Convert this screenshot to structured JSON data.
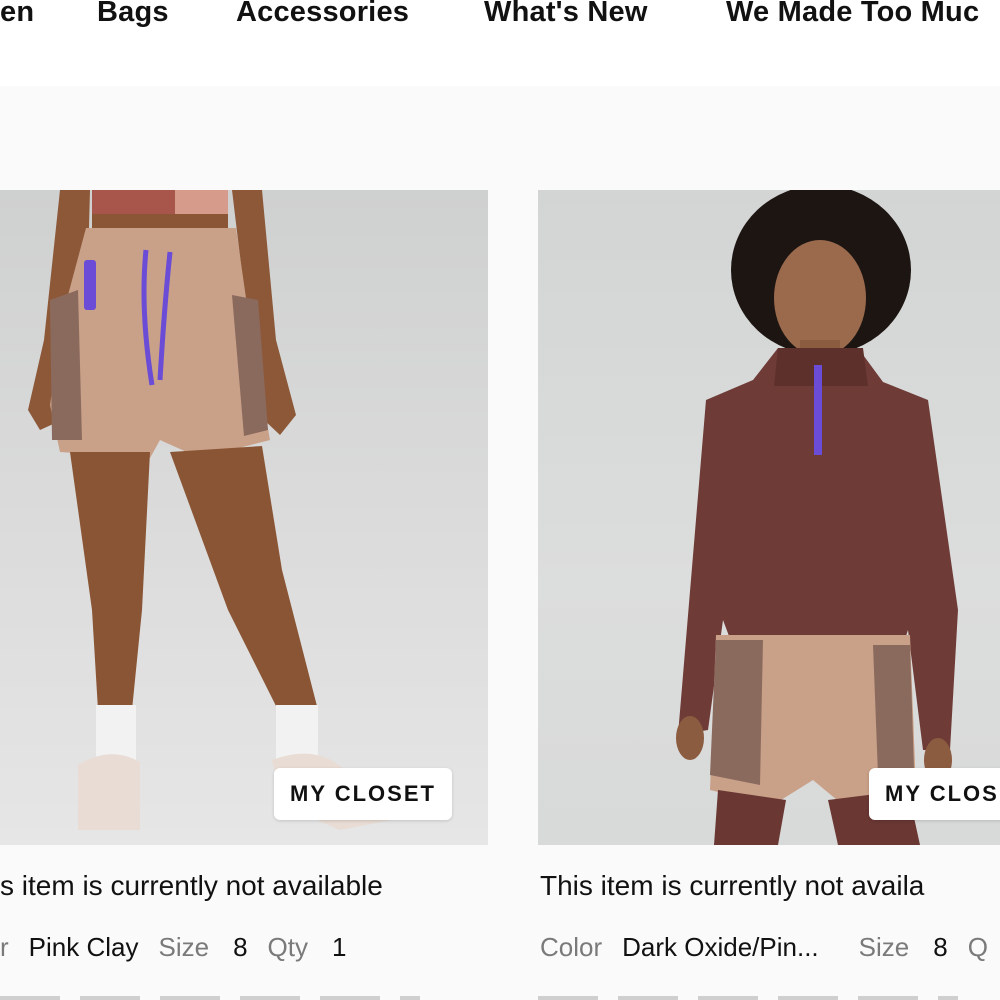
{
  "nav": {
    "items": [
      {
        "label": "en"
      },
      {
        "label": "Bags"
      },
      {
        "label": "Accessories"
      },
      {
        "label": "What's New"
      },
      {
        "label": "We Made Too Muc"
      }
    ]
  },
  "products": [
    {
      "closet_label": "MY CLOSET",
      "availability": "s item is currently not available",
      "color_label": "r",
      "color_value": "Pink Clay",
      "size_label": "Size",
      "size_value": "8",
      "qty_label": "Qty",
      "qty_value": "1"
    },
    {
      "closet_label": "MY CLOS",
      "availability": "This item is currently not availa",
      "color_label": "Color",
      "color_value": "Dark Oxide/Pin...",
      "size_label": "Size",
      "size_value": "8",
      "qty_label": "Q"
    }
  ],
  "colors": {
    "shorts": "#c9a088",
    "top": "#6e3b36",
    "accent": "#6a4cd6"
  }
}
